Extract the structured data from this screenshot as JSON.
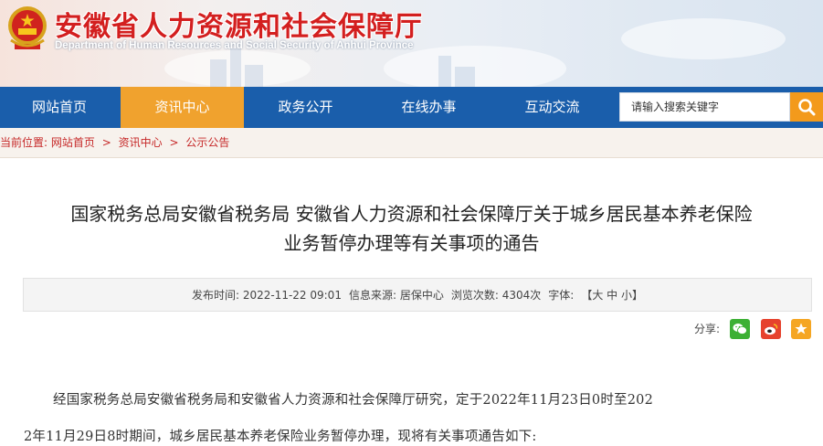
{
  "header": {
    "site_title": "安徽省人力资源和社会保障厅",
    "site_subtitle": "Department of Human Resources and Social Security of Anhui Province"
  },
  "nav": {
    "items": [
      {
        "label": "网站首页"
      },
      {
        "label": "资讯中心"
      },
      {
        "label": "政务公开"
      },
      {
        "label": "在线办事"
      },
      {
        "label": "互动交流"
      }
    ],
    "active_index": 1,
    "search_placeholder": "请输入搜索关键字"
  },
  "breadcrumb": {
    "prefix": "当前位置:",
    "items": [
      "网站首页",
      "资讯中心",
      "公示公告"
    ],
    "separator": ">"
  },
  "article": {
    "title_line1": "国家税务总局安徽省税务局 安徽省人力资源和社会保障厅关于城乡居民基本养老保险",
    "title_line2": "业务暂停办理等有关事项的通告",
    "meta": {
      "publish_label": "发布时间:",
      "publish_time": "2022-11-22 09:01",
      "source_label": "信息来源:",
      "source": "居保中心",
      "views_label": "浏览次数:",
      "views": "4304次",
      "font_label": "字体:",
      "font_open": "【",
      "font_large": "大",
      "font_medium": "中",
      "font_small": "小",
      "font_close": "】"
    },
    "share_label": "分享:",
    "body_line1": "经国家税务总局安徽省税务局和安徽省人力资源和社会保障厅研究，定于2022年11月23日0时至202",
    "body_line2": "2年11月29日8时期间，城乡居民基本养老保险业务暂停办理，现将有关事项通告如下:"
  },
  "colors": {
    "nav_bg": "#1a5eab",
    "nav_active": "#f0a22e",
    "title_red": "#d31f1f",
    "search_btn": "#f39a1c",
    "wechat": "#3cb034",
    "weibo": "#e6422d",
    "favorite": "#f5a623"
  },
  "icons": {
    "emblem": "national-emblem-icon",
    "search": "search-icon",
    "wechat": "wechat-icon",
    "weibo": "weibo-icon",
    "favorite": "star-icon"
  }
}
